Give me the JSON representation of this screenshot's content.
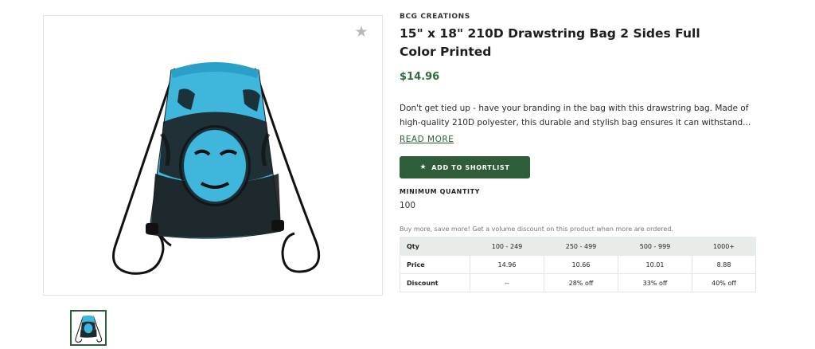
{
  "product": {
    "brand": "BCG CREATIONS",
    "title": "15\" x 18\" 210D Drawstring Bag 2 Sides Full Color Printed",
    "price": "$14.96",
    "description": "Don't get tied up - have your branding in the bag with this drawstring bag. Made of high-quality 210D polyester, this durable and stylish bag ensures it can withstand...",
    "read_more": "READ MORE",
    "shortlist_button": "ADD TO SHORTLIST",
    "min_quantity_label": "MINIMUM QUANTITY",
    "min_quantity_value": "100",
    "volume_note": "Buy more, save more! Get a volume discount on this product when more are ordered."
  },
  "pricing_table": {
    "header": [
      "Qty",
      "100 - 249",
      "250 - 499",
      "500 - 999",
      "1000+"
    ],
    "rows": [
      [
        "Price",
        "14.96",
        "10.66",
        "10.01",
        "8.88"
      ],
      [
        "Discount",
        "--",
        "28% off",
        "33% off",
        "40% off"
      ]
    ]
  },
  "icons": {
    "favorite": "star-icon",
    "button": "star-icon"
  },
  "colors": {
    "brand_green": "#2f5d3a",
    "price_green": "#2f6b3d",
    "bag_blue": "#3fb6dc",
    "table_header_bg": "#e8ece9"
  }
}
